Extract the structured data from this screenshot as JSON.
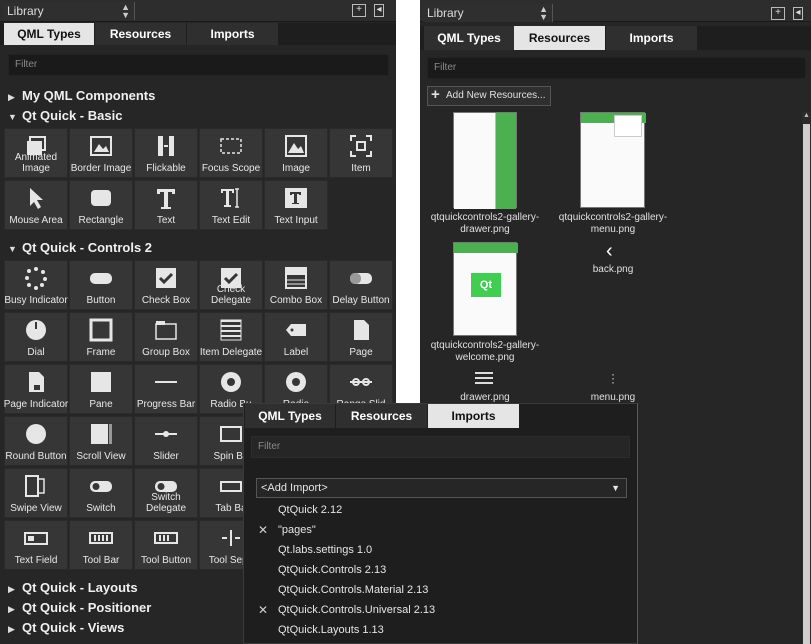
{
  "panel_a": {
    "library_label": "Library",
    "tabs": [
      "QML Types",
      "Resources",
      "Imports"
    ],
    "filter_placeholder": "Filter",
    "sections": {
      "my_qml": "My QML Components",
      "basic": "Qt Quick - Basic",
      "controls2": "Qt Quick - Controls 2",
      "layouts": "Qt Quick - Layouts",
      "positioner": "Qt Quick - Positioner",
      "views": "Qt Quick - Views"
    },
    "basic_items": [
      "Animated Image",
      "Border Image",
      "Flickable",
      "Focus Scope",
      "Image",
      "Item",
      "Mouse Area",
      "Rectangle",
      "Text",
      "Text Edit",
      "Text Input"
    ],
    "controls_items": [
      "Busy Indicator",
      "Button",
      "Check Box",
      "Check Delegate",
      "Combo Box",
      "Delay Button",
      "Dial",
      "Frame",
      "Group Box",
      "Item Delegate",
      "Label",
      "Page",
      "Page Indicator",
      "Pane",
      "Progress Bar",
      "Radio Bu",
      "Radio",
      "Range Slid",
      "Round Button",
      "Scroll View",
      "Slider",
      "Spin Bo",
      "",
      "",
      "Swipe View",
      "Switch",
      "Switch Delegate",
      "Tab Ba",
      "",
      "",
      "Text Field",
      "Tool Bar",
      "Tool Button",
      "Tool Sepa",
      "",
      ""
    ]
  },
  "panel_b": {
    "library_label": "Library",
    "tabs": [
      "QML Types",
      "Resources",
      "Imports"
    ],
    "filter_placeholder": "Filter",
    "add_button": "Add New Resources...",
    "resources": [
      "qtquickcontrols2-gallery-drawer.png",
      "qtquickcontrols2-gallery-menu.png",
      "back.png",
      "qtquickcontrols2-gallery-welcome.png",
      "drawer.png",
      "menu.png"
    ]
  },
  "panel_c": {
    "tabs": [
      "QML Types",
      "Resources",
      "Imports"
    ],
    "filter_placeholder": "Filter",
    "add_import": "<Add Import>",
    "imports": [
      {
        "label": "QtQuick 2.12",
        "removable": false
      },
      {
        "label": "\"pages\"",
        "removable": true
      },
      {
        "label": "Qt.labs.settings 1.0",
        "removable": false
      },
      {
        "label": "QtQuick.Controls 2.13",
        "removable": false
      },
      {
        "label": "QtQuick.Controls.Material 2.13",
        "removable": false
      },
      {
        "label": "QtQuick.Controls.Universal 2.13",
        "removable": true
      },
      {
        "label": "QtQuick.Layouts 1.13",
        "removable": false
      }
    ]
  },
  "colors": {
    "panel_bg": "#262626",
    "cell_bg": "#363636",
    "active_tab": "#e5e5e5",
    "qt_green": "#41cd52"
  }
}
